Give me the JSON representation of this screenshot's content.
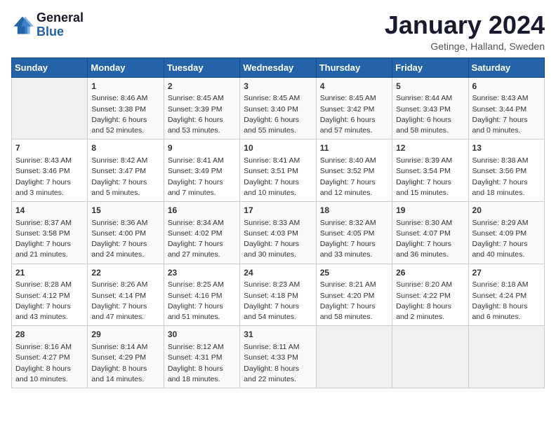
{
  "logo": {
    "line1": "General",
    "line2": "Blue"
  },
  "title": "January 2024",
  "location": "Getinge, Halland, Sweden",
  "weekdays": [
    "Sunday",
    "Monday",
    "Tuesday",
    "Wednesday",
    "Thursday",
    "Friday",
    "Saturday"
  ],
  "weeks": [
    [
      {
        "day": "",
        "info": ""
      },
      {
        "day": "1",
        "info": "Sunrise: 8:46 AM\nSunset: 3:38 PM\nDaylight: 6 hours\nand 52 minutes."
      },
      {
        "day": "2",
        "info": "Sunrise: 8:45 AM\nSunset: 3:39 PM\nDaylight: 6 hours\nand 53 minutes."
      },
      {
        "day": "3",
        "info": "Sunrise: 8:45 AM\nSunset: 3:40 PM\nDaylight: 6 hours\nand 55 minutes."
      },
      {
        "day": "4",
        "info": "Sunrise: 8:45 AM\nSunset: 3:42 PM\nDaylight: 6 hours\nand 57 minutes."
      },
      {
        "day": "5",
        "info": "Sunrise: 8:44 AM\nSunset: 3:43 PM\nDaylight: 6 hours\nand 58 minutes."
      },
      {
        "day": "6",
        "info": "Sunrise: 8:43 AM\nSunset: 3:44 PM\nDaylight: 7 hours\nand 0 minutes."
      }
    ],
    [
      {
        "day": "7",
        "info": "Sunrise: 8:43 AM\nSunset: 3:46 PM\nDaylight: 7 hours\nand 3 minutes."
      },
      {
        "day": "8",
        "info": "Sunrise: 8:42 AM\nSunset: 3:47 PM\nDaylight: 7 hours\nand 5 minutes."
      },
      {
        "day": "9",
        "info": "Sunrise: 8:41 AM\nSunset: 3:49 PM\nDaylight: 7 hours\nand 7 minutes."
      },
      {
        "day": "10",
        "info": "Sunrise: 8:41 AM\nSunset: 3:51 PM\nDaylight: 7 hours\nand 10 minutes."
      },
      {
        "day": "11",
        "info": "Sunrise: 8:40 AM\nSunset: 3:52 PM\nDaylight: 7 hours\nand 12 minutes."
      },
      {
        "day": "12",
        "info": "Sunrise: 8:39 AM\nSunset: 3:54 PM\nDaylight: 7 hours\nand 15 minutes."
      },
      {
        "day": "13",
        "info": "Sunrise: 8:38 AM\nSunset: 3:56 PM\nDaylight: 7 hours\nand 18 minutes."
      }
    ],
    [
      {
        "day": "14",
        "info": "Sunrise: 8:37 AM\nSunset: 3:58 PM\nDaylight: 7 hours\nand 21 minutes."
      },
      {
        "day": "15",
        "info": "Sunrise: 8:36 AM\nSunset: 4:00 PM\nDaylight: 7 hours\nand 24 minutes."
      },
      {
        "day": "16",
        "info": "Sunrise: 8:34 AM\nSunset: 4:02 PM\nDaylight: 7 hours\nand 27 minutes."
      },
      {
        "day": "17",
        "info": "Sunrise: 8:33 AM\nSunset: 4:03 PM\nDaylight: 7 hours\nand 30 minutes."
      },
      {
        "day": "18",
        "info": "Sunrise: 8:32 AM\nSunset: 4:05 PM\nDaylight: 7 hours\nand 33 minutes."
      },
      {
        "day": "19",
        "info": "Sunrise: 8:30 AM\nSunset: 4:07 PM\nDaylight: 7 hours\nand 36 minutes."
      },
      {
        "day": "20",
        "info": "Sunrise: 8:29 AM\nSunset: 4:09 PM\nDaylight: 7 hours\nand 40 minutes."
      }
    ],
    [
      {
        "day": "21",
        "info": "Sunrise: 8:28 AM\nSunset: 4:12 PM\nDaylight: 7 hours\nand 43 minutes."
      },
      {
        "day": "22",
        "info": "Sunrise: 8:26 AM\nSunset: 4:14 PM\nDaylight: 7 hours\nand 47 minutes."
      },
      {
        "day": "23",
        "info": "Sunrise: 8:25 AM\nSunset: 4:16 PM\nDaylight: 7 hours\nand 51 minutes."
      },
      {
        "day": "24",
        "info": "Sunrise: 8:23 AM\nSunset: 4:18 PM\nDaylight: 7 hours\nand 54 minutes."
      },
      {
        "day": "25",
        "info": "Sunrise: 8:21 AM\nSunset: 4:20 PM\nDaylight: 7 hours\nand 58 minutes."
      },
      {
        "day": "26",
        "info": "Sunrise: 8:20 AM\nSunset: 4:22 PM\nDaylight: 8 hours\nand 2 minutes."
      },
      {
        "day": "27",
        "info": "Sunrise: 8:18 AM\nSunset: 4:24 PM\nDaylight: 8 hours\nand 6 minutes."
      }
    ],
    [
      {
        "day": "28",
        "info": "Sunrise: 8:16 AM\nSunset: 4:27 PM\nDaylight: 8 hours\nand 10 minutes."
      },
      {
        "day": "29",
        "info": "Sunrise: 8:14 AM\nSunset: 4:29 PM\nDaylight: 8 hours\nand 14 minutes."
      },
      {
        "day": "30",
        "info": "Sunrise: 8:12 AM\nSunset: 4:31 PM\nDaylight: 8 hours\nand 18 minutes."
      },
      {
        "day": "31",
        "info": "Sunrise: 8:11 AM\nSunset: 4:33 PM\nDaylight: 8 hours\nand 22 minutes."
      },
      {
        "day": "",
        "info": ""
      },
      {
        "day": "",
        "info": ""
      },
      {
        "day": "",
        "info": ""
      }
    ]
  ]
}
